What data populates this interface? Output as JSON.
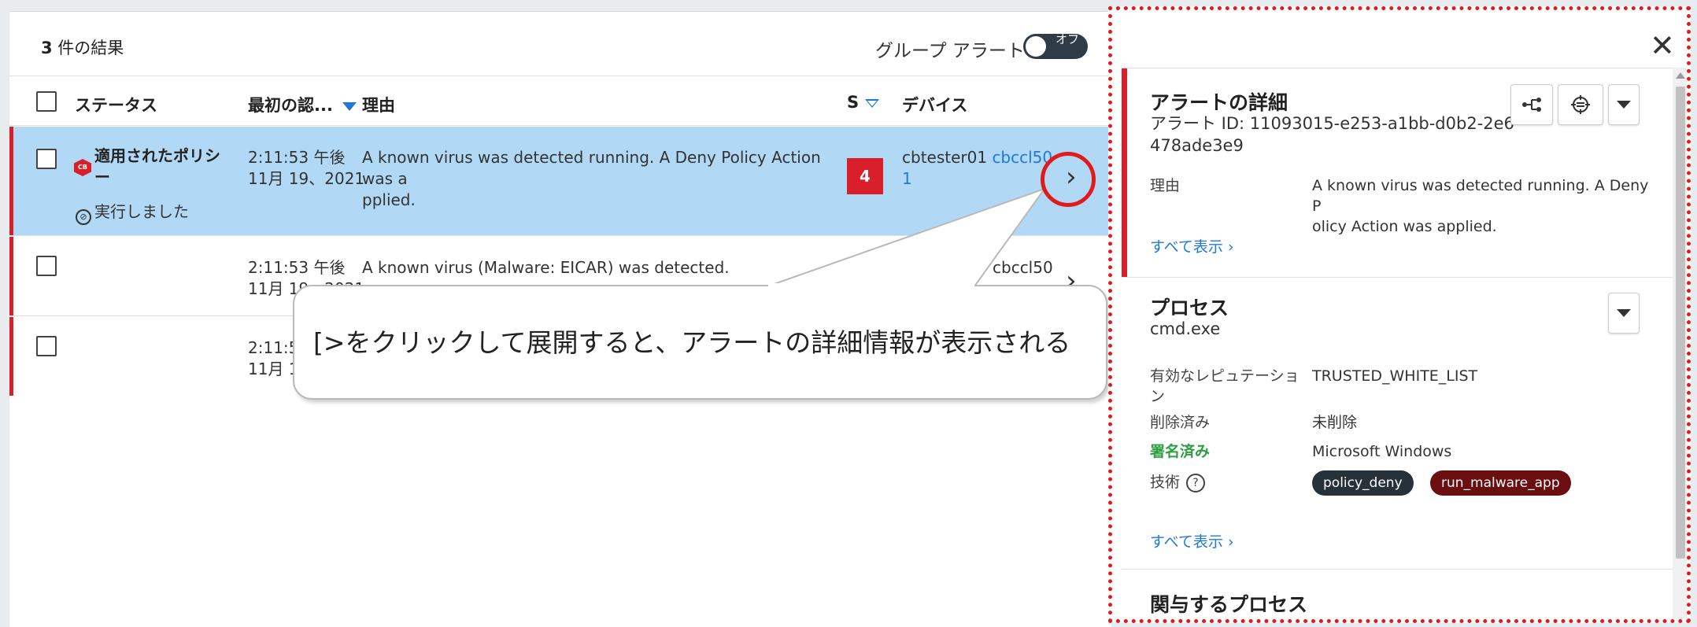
{
  "results": {
    "count": "3",
    "count_suffix": " 件の結果",
    "group_alerts_label": "グループ アラート",
    "group_toggle_text": "オフ"
  },
  "columns": {
    "status": "ステータス",
    "first_seen": "最初の認...",
    "reason": "理由",
    "severity": "S",
    "device": "デバイス"
  },
  "rows": [
    {
      "status_line1": "適用されたポリシ",
      "status_line2": "ー",
      "status_action": "実行しました",
      "policy_icon_text": "CB",
      "time_line1": "2:11:53 午後",
      "time_line2": "11月 19、2021",
      "reason_line1": "A known virus was detected running. A Deny Policy Action was a",
      "reason_line2": "pplied.",
      "severity": "4",
      "device_name": "cbtester01",
      "device_link_line1": "cbccl50",
      "device_link_line2": "1"
    },
    {
      "time_line1": "2:11:53 午後",
      "time_line2": "11月 19、2021",
      "reason_line1": "A known virus (Malware: EICAR) was detected.",
      "device_link_line1": "cbccl50"
    },
    {
      "time_line1": "2:11:5",
      "time_line2": "11月 1"
    }
  ],
  "callout": {
    "text": "[>をクリックして展開すると、アラートの詳細情報が表示される"
  },
  "details": {
    "alert_title": "アラートの詳細",
    "alert_id_line1": "アラート ID: 11093015-e253-a1bb-d0b2-2e6",
    "alert_id_line2": "478ade3e9",
    "reason_label": "理由",
    "reason_line1": "A known virus was detected running. A Deny P",
    "reason_line2": "olicy Action was applied.",
    "show_all": "すべて表示",
    "process_title": "プロセス",
    "process_name": "cmd.exe",
    "reputation_label_line1": "有効なレピュテーショ",
    "reputation_label_line2": "ン",
    "reputation_value": "TRUSTED_WHITE_LIST",
    "deleted_label": "削除済み",
    "deleted_value": "未削除",
    "signed_label": "署名済み",
    "signed_value": "Microsoft Windows",
    "technique_label": "技術",
    "tags": [
      {
        "label": "policy_deny",
        "color": "#27313a"
      },
      {
        "label": "run_malware_app",
        "color": "#6a0e10"
      }
    ],
    "involved_title": "関与するプロセス"
  },
  "colors": {
    "accent_red": "#d81f2a",
    "link_blue": "#1f7ad6",
    "selected_row": "#b1d9f5",
    "signed_green": "#2e9e44"
  }
}
